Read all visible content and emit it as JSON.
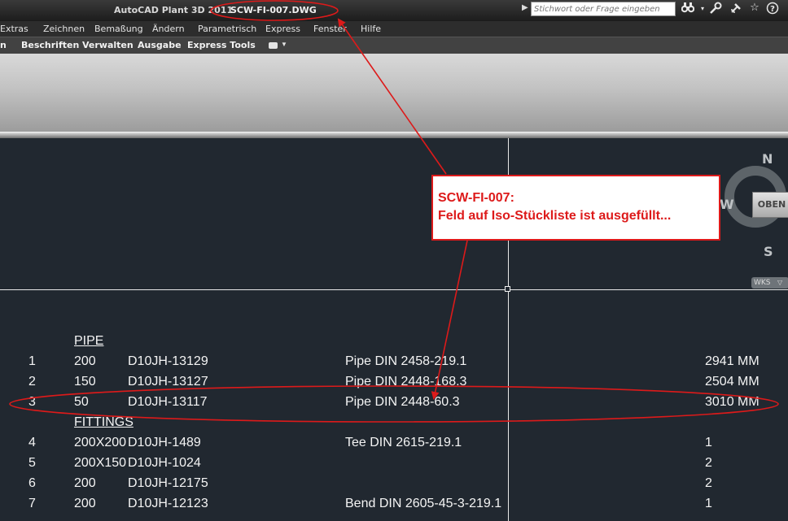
{
  "titlebar": {
    "app_title": "AutoCAD Plant 3D 2011",
    "file_name": "SCW-FI-007.DWG",
    "search_placeholder": "Stichwort oder Frage eingeben",
    "search_arrow_icon": "play-arrow-icon",
    "icons": [
      "binoculars-icon",
      "tools-icon",
      "satellite-icon",
      "star-icon",
      "help-icon"
    ]
  },
  "menu": {
    "items": [
      "Extras",
      "Zeichnen",
      "Bemaßung",
      "Ändern",
      "Parametrisch",
      "Express",
      "Fenster",
      "Hilfe"
    ]
  },
  "ribbon_tabs": {
    "items": [
      "n",
      "Beschriften",
      "Verwalten",
      "Ausgabe",
      "Express Tools"
    ],
    "dropdown_icon": "ribbon-toggle-icon"
  },
  "viewcube": {
    "north": "N",
    "south": "S",
    "west": "W",
    "face": "OBEN",
    "wcs": "WKS"
  },
  "bom": {
    "pipe_header": "PIPE",
    "fittings_header": "FITTINGS",
    "rows": [
      {
        "pos": "1",
        "size": "200",
        "code": "D10JH-13129",
        "desc": "Pipe DIN 2458-219.1",
        "qty": "2941 MM"
      },
      {
        "pos": "2",
        "size": "150",
        "code": "D10JH-13127",
        "desc": "Pipe DIN 2448-168.3",
        "qty": "2504 MM"
      },
      {
        "pos": "3",
        "size": "50",
        "code": "D10JH-13117",
        "desc": "Pipe DIN 2448-60.3",
        "qty": "3010 MM"
      },
      {
        "pos": "4",
        "size": "200X200",
        "code": "D10JH-1489",
        "desc": "Tee DIN 2615-219.1",
        "qty": "1"
      },
      {
        "pos": "5",
        "size": "200X150",
        "code": "D10JH-1024",
        "desc": "",
        "qty": "2"
      },
      {
        "pos": "6",
        "size": "200",
        "code": "D10JH-12175",
        "desc": "",
        "qty": "2"
      },
      {
        "pos": "7",
        "size": "200",
        "code": "D10JH-12123",
        "desc": "Bend DIN 2605-45-3-219.1",
        "qty": "1"
      }
    ]
  },
  "callout": {
    "line1": "SCW-FI-007:",
    "line2": "Feld auf Iso-Stückliste ist ausgefüllt..."
  },
  "colors": {
    "annotation_red": "#dd1a1a",
    "canvas_bg": "#212830"
  }
}
